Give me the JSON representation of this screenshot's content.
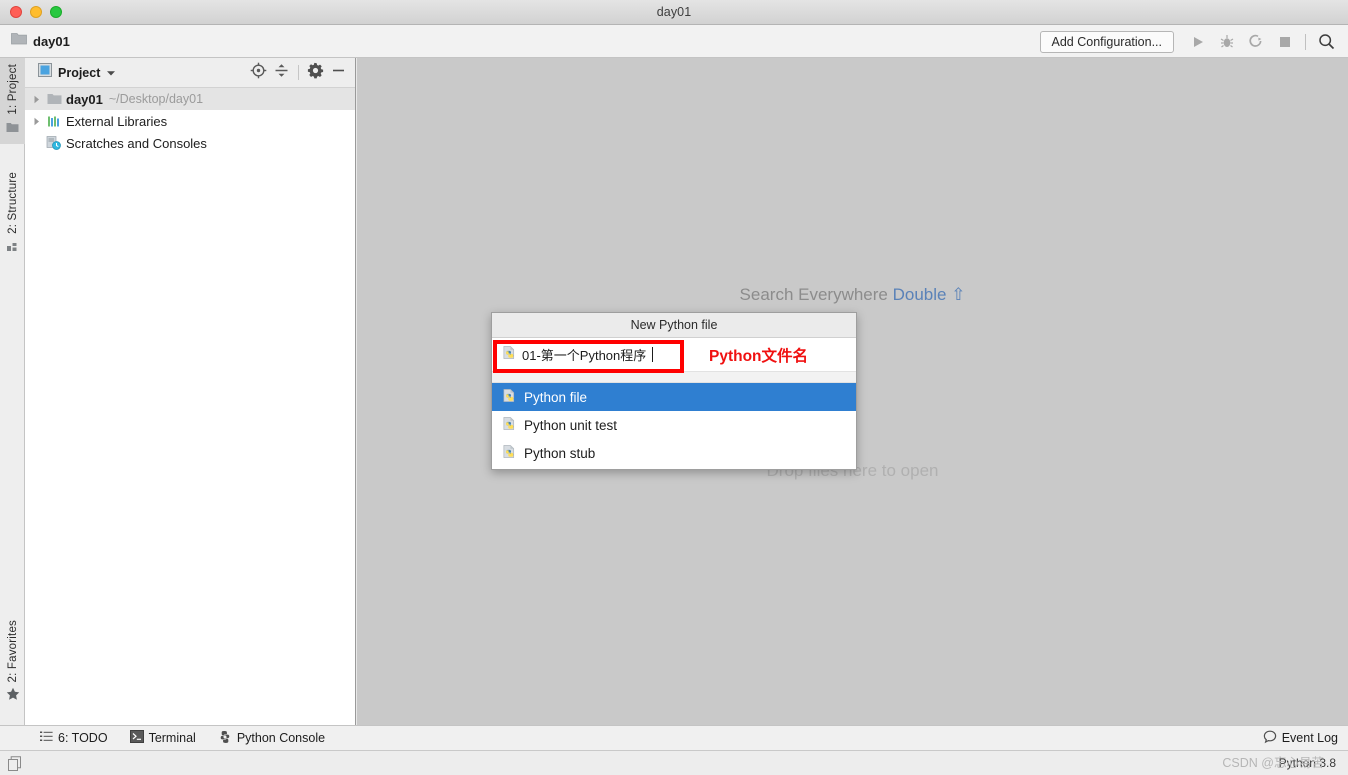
{
  "window": {
    "title": "day01",
    "traffic_lights": [
      "close-button",
      "minimize-button",
      "maximize-button"
    ]
  },
  "navbar": {
    "breadcrumb": "day01",
    "breadcrumb_icon": "folder-icon",
    "add_configuration_label": "Add Configuration...",
    "icons": [
      {
        "name": "run-icon",
        "glyph": "▶"
      },
      {
        "name": "debug-icon",
        "glyph": "bug"
      },
      {
        "name": "run-coverage-icon",
        "glyph": "coverage"
      },
      {
        "name": "stop-icon",
        "glyph": "■"
      },
      {
        "name": "search-icon",
        "glyph": "search"
      }
    ]
  },
  "left_strip": {
    "tabs": [
      {
        "name": "sidebar-tab-project",
        "label": "1: Project",
        "underline": "1",
        "icon": "folder-icon",
        "active": true
      },
      {
        "name": "sidebar-tab-structure",
        "label": "2: Structure",
        "underline": "2",
        "icon": "structure-icon",
        "active": false
      },
      {
        "name": "sidebar-tab-favorites",
        "label": "2: Favorites",
        "underline": "2",
        "icon": "star-icon",
        "active": false
      }
    ]
  },
  "project_panel": {
    "header": {
      "title": "Project",
      "title_icon": "project-view-icon",
      "dropdown_icon": "chevron-down-icon",
      "actions": [
        {
          "name": "scroll-from-source-icon",
          "label": "Select Opened File"
        },
        {
          "name": "collapse-all-icon",
          "label": "Collapse All"
        },
        {
          "name": "settings-gear-icon",
          "label": "Settings"
        },
        {
          "name": "hide-panel-icon",
          "label": "Hide"
        }
      ]
    },
    "tree": [
      {
        "name": "tree-node-day01",
        "label": "day01",
        "path": "~/Desktop/day01",
        "icon": "folder-icon",
        "arrow": true,
        "bold": true,
        "selected": true,
        "indent": 0
      },
      {
        "name": "tree-node-external-libraries",
        "label": "External Libraries",
        "path": "",
        "icon": "libraries-icon",
        "arrow": true,
        "bold": false,
        "selected": false,
        "indent": 0
      },
      {
        "name": "tree-node-scratches-and-consoles",
        "label": "Scratches and Consoles",
        "path": "",
        "icon": "scratches-icon",
        "arrow": false,
        "bold": false,
        "selected": false,
        "indent": 0
      }
    ]
  },
  "editor": {
    "hint_search_prefix": "Search Everywhere",
    "hint_search_shortcut": "Double ⇧",
    "hint_drop": "Drop files here to open"
  },
  "popup": {
    "title": "New Python file",
    "input_value": "01-第一个Python程序",
    "input_icon": "python-file-icon",
    "annotation_label": "Python文件名",
    "annotation_color": "#ff0000",
    "options": [
      {
        "name": "popup-option-python-file",
        "label": "Python file",
        "icon": "python-file-icon",
        "selected": true
      },
      {
        "name": "popup-option-python-unit-test",
        "label": "Python unit test",
        "icon": "python-file-icon",
        "selected": false
      },
      {
        "name": "popup-option-python-stub",
        "label": "Python stub",
        "icon": "python-file-icon",
        "selected": false
      }
    ],
    "selection_color": "#2f7fd1"
  },
  "bottom_bar": {
    "items": [
      {
        "name": "tool-window-todo",
        "label": "6: TODO",
        "underline": "6",
        "icon": "todo-icon"
      },
      {
        "name": "tool-window-terminal",
        "label": "Terminal",
        "icon": "terminal-icon"
      },
      {
        "name": "tool-window-python-console",
        "label": "Python Console",
        "icon": "python-icon"
      }
    ],
    "event_log_label": "Event Log",
    "event_log_icon": "balloon-icon"
  },
  "status_bar": {
    "interpreter": "Python 3.8",
    "watermark": "CSDN @忘心易苦",
    "memory_icon": "memory-indicator-icon"
  }
}
